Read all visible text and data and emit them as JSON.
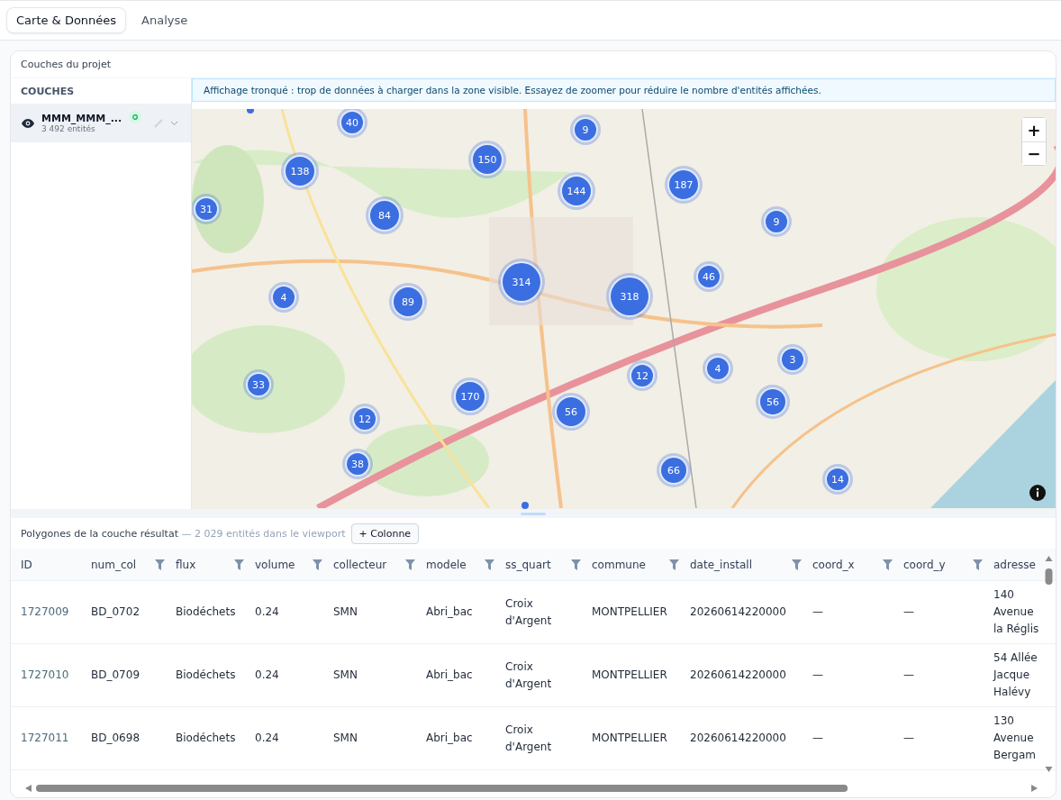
{
  "tabs": [
    {
      "label": "Carte & Données",
      "selected": true
    },
    {
      "label": "Analyse",
      "selected": false
    }
  ],
  "panel": {
    "title": "Couches du projet"
  },
  "sidebar": {
    "heading": "COUCHES",
    "layers": [
      {
        "name": "MMM_MMM_...",
        "count": "3 492 entités",
        "visible": true,
        "selected": true
      }
    ]
  },
  "banner": "Affichage tronqué : trop de données à charger dans la zone visible. Essayez de zoomer pour réduire le nombre d'entités affichées.",
  "map": {
    "zoom_in": "+",
    "zoom_out": "−",
    "clusters": [
      "40",
      "9",
      "150",
      "138",
      "187",
      "144",
      "31",
      "84",
      "9",
      "4",
      "89",
      "314",
      "318",
      "46",
      "3",
      "4",
      "12",
      "33",
      "170",
      "56",
      "56",
      "12",
      "38",
      "66",
      "14"
    ]
  },
  "table": {
    "title": "Polygones de la couche résultat",
    "subtitle": "— 2 029 entités dans le viewport",
    "add_column": "+ Colonne",
    "columns": [
      {
        "label": "ID",
        "filterable": false
      },
      {
        "label": "num_col",
        "filterable": true
      },
      {
        "label": "flux",
        "filterable": true
      },
      {
        "label": "volume",
        "filterable": true
      },
      {
        "label": "collecteur",
        "filterable": true
      },
      {
        "label": "modele",
        "filterable": true
      },
      {
        "label": "ss_quart",
        "filterable": true
      },
      {
        "label": "commune",
        "filterable": true
      },
      {
        "label": "date_install",
        "filterable": true
      },
      {
        "label": "coord_x",
        "filterable": true
      },
      {
        "label": "coord_y",
        "filterable": true
      },
      {
        "label": "adresse"
      }
    ],
    "rows": [
      [
        "1727009",
        "BD_0702",
        "Biodéchets",
        "0.24",
        "SMN",
        "Abri_bac",
        "Croix d'Argent",
        "MONTPELLIER",
        "20260614220000",
        "—",
        "—",
        "140 Avenue la Réglis"
      ],
      [
        "1727010",
        "BD_0709",
        "Biodéchets",
        "0.24",
        "SMN",
        "Abri_bac",
        "Croix d'Argent",
        "MONTPELLIER",
        "20260614220000",
        "—",
        "—",
        "54 Allée Jacque Halévy"
      ],
      [
        "1727011",
        "BD_0698",
        "Biodéchets",
        "0.24",
        "SMN",
        "Abri_bac",
        "Croix d'Argent",
        "MONTPELLIER",
        "20260614220000",
        "—",
        "—",
        "130 Avenue Bergam"
      ]
    ]
  }
}
